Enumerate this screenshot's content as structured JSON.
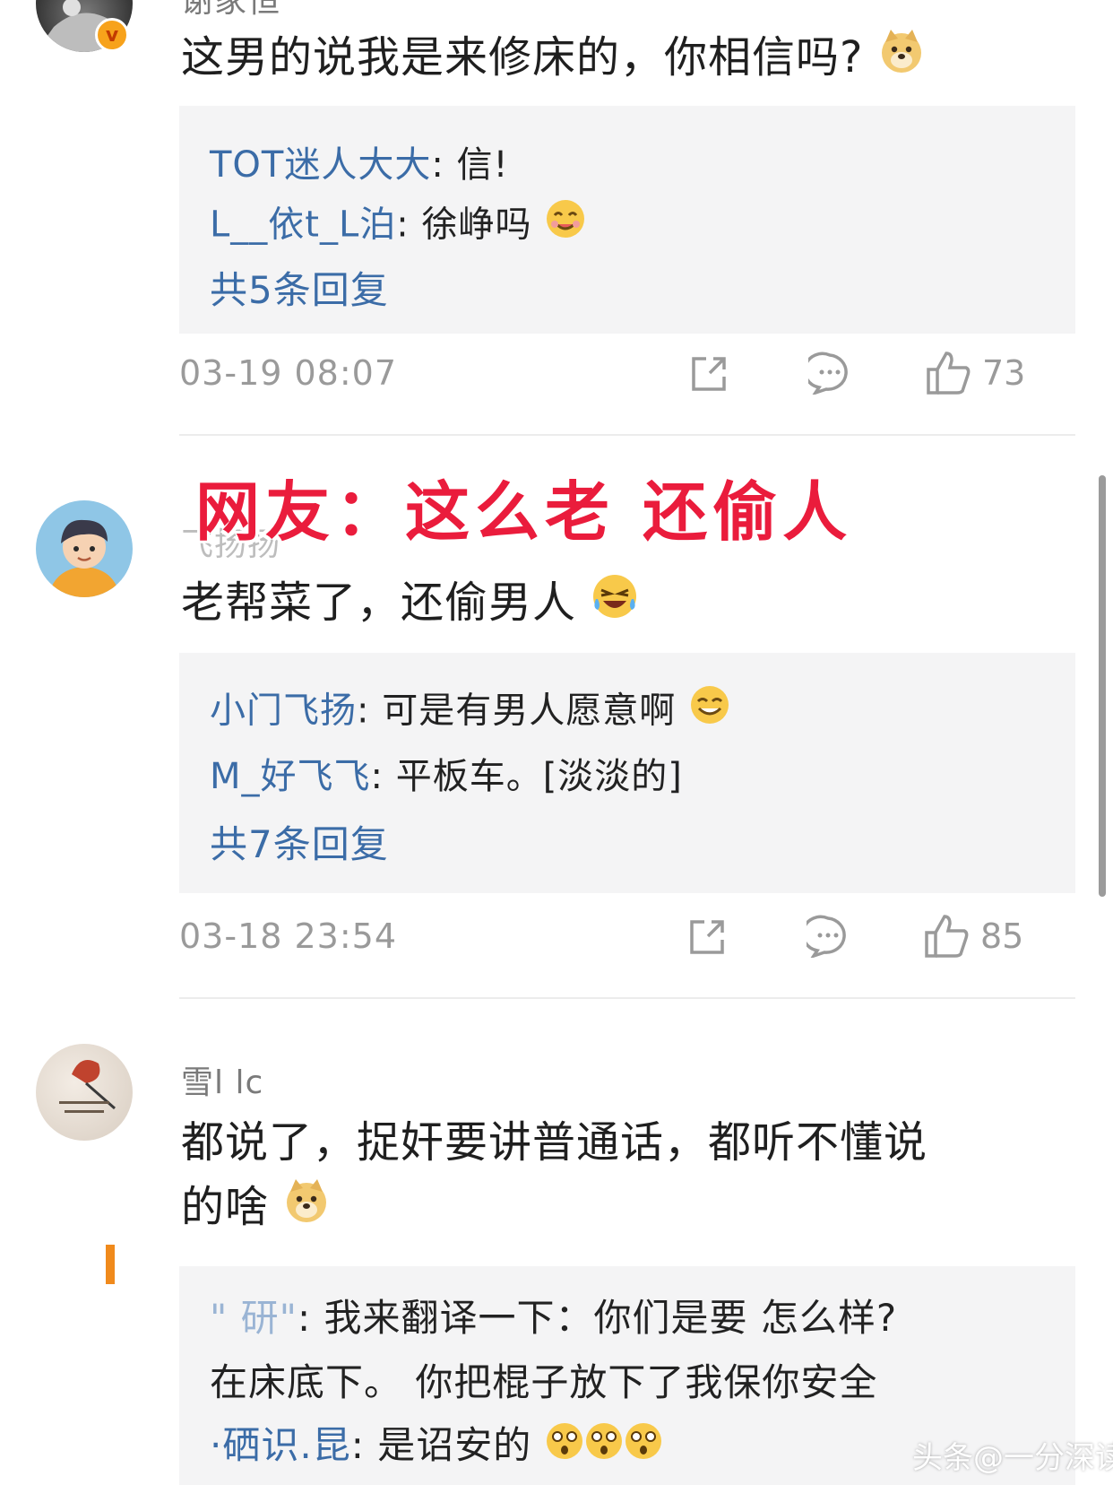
{
  "overlay_caption": "网友：这么老 还偷人",
  "comments": [
    {
      "username": "谢家恒",
      "text": "这男的说我是来修床的，你相信吗?",
      "replies": [
        {
          "name": "TOT迷人大大",
          "text": ": 信!"
        },
        {
          "name": "L__依t_L泊",
          "text": ": 徐峥吗"
        }
      ],
      "reply_count_label": "共5条回复",
      "timestamp": "03-19 08:07",
      "like_count": "73"
    },
    {
      "username": "飞扬扬",
      "text": "老帮菜了，还偷男人",
      "replies": [
        {
          "name": "小门飞扬",
          "text": ": 可是有男人愿意啊"
        },
        {
          "name": "M_好飞飞",
          "text": ": 平板车。[淡淡的]"
        }
      ],
      "reply_count_label": "共7条回复",
      "timestamp": "03-18 23:54",
      "like_count": "85"
    },
    {
      "username": "雪l lc",
      "text_line1": "都说了，捉奸要讲普通话，都听不懂说",
      "text_line2": "的啥",
      "replies": [
        {
          "name": "\" 研\"",
          "text": ": 我来翻译一下：你们是要 怎么样?"
        },
        {
          "name": "",
          "text": "在床底下。 你把棍子放下了我保你安全"
        },
        {
          "name": "·硒识.昆",
          "text": ": 是诏安的"
        }
      ]
    }
  ],
  "watermark": "头条@一分深读",
  "colors": {
    "link": "#3b6ca7",
    "overlay": "#ea1c3c",
    "reply_bg": "#f4f4f5",
    "meta_gray": "#9a9a9a"
  }
}
